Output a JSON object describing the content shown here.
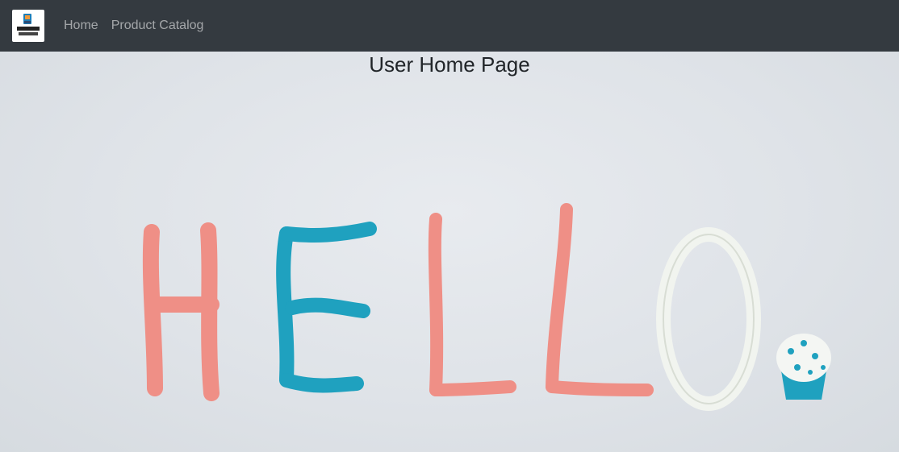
{
  "navbar": {
    "logo_top_text": "SMART",
    "logo_bottom_text": "SHOPPING",
    "links": [
      {
        "label": "Home"
      },
      {
        "label": "Product Catalog"
      }
    ]
  },
  "main": {
    "title": "User Home Page",
    "hero_image_icon": "hello-clay-letters-image"
  },
  "colors": {
    "navbar_bg": "#343a40",
    "nav_link": "#a7a9ac",
    "clay_pink": "#ef8f86",
    "clay_blue": "#1fa1bf",
    "clay_white": "#f1f4ef",
    "background": "#dfe3e8"
  }
}
